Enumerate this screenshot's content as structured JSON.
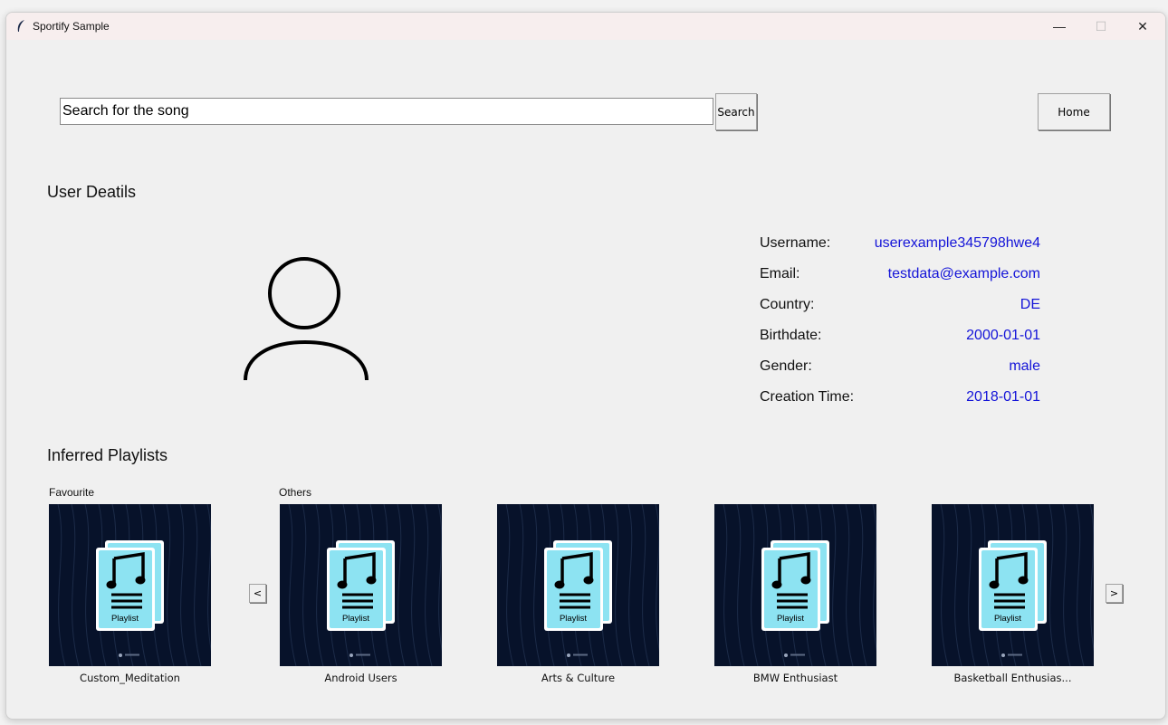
{
  "window": {
    "title": "Sportify Sample",
    "minimize_glyph": "—",
    "maximize_glyph": "☐",
    "close_glyph": "✕"
  },
  "search": {
    "value": "Search for the song",
    "button_label": "Search"
  },
  "home_button_label": "Home",
  "user_section": {
    "heading": "User Deatils",
    "avatar_icon": "user-avatar-icon",
    "details": [
      {
        "label": "Username:",
        "value": "userexample345798hwe4"
      },
      {
        "label": "Email:",
        "value": "testdata@example.com"
      },
      {
        "label": "Country:",
        "value": "DE"
      },
      {
        "label": "Birthdate:",
        "value": "2000-01-01"
      },
      {
        "label": "Gender:",
        "value": "male"
      },
      {
        "label": "Creation Time:",
        "value": "2018-01-01"
      }
    ],
    "value_color": "#1414d8"
  },
  "playlists_section": {
    "heading": "Inferred Playlists",
    "favourite_label": "Favourite",
    "others_label": "Others",
    "prev_label": "<",
    "next_label": ">",
    "cover_text": "Playlist",
    "cover_icon": "music-note-icon",
    "cover_bg_color": "#07122a",
    "cover_card_color": "#8de3f2",
    "items": [
      {
        "name": "Custom_Meditation"
      },
      {
        "name": "Android Users"
      },
      {
        "name": "Arts & Culture"
      },
      {
        "name": "BMW Enthusiast"
      },
      {
        "name": "Basketball Enthusias..."
      }
    ]
  }
}
